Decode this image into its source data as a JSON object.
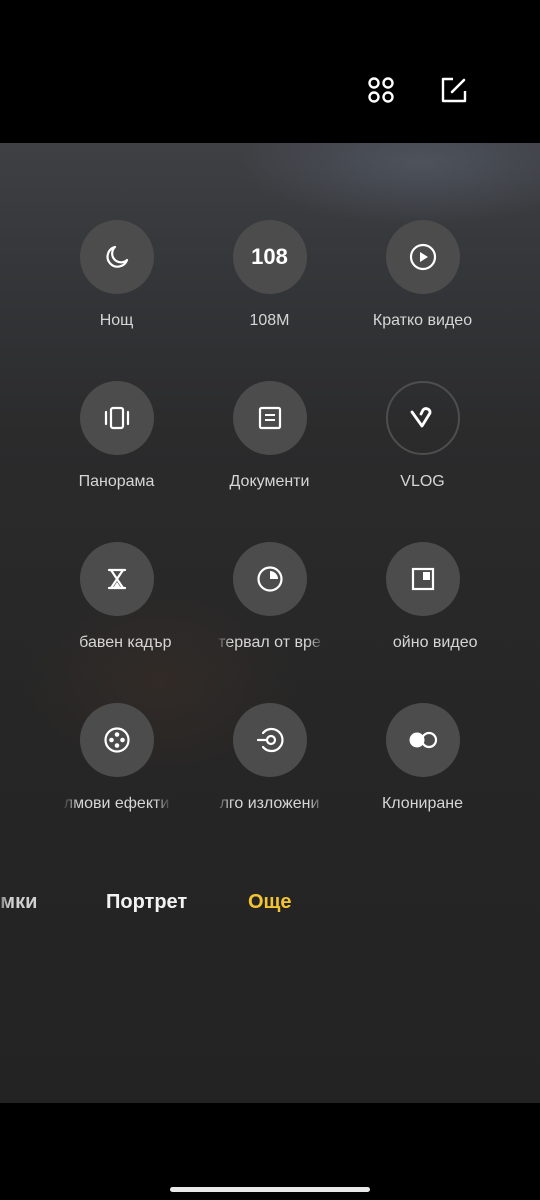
{
  "toolbar": {
    "grid_icon": "grid-icon",
    "edit_icon": "edit-icon"
  },
  "modes": [
    {
      "label": "Нощ",
      "icon": "moon-icon"
    },
    {
      "label": "108M",
      "icon": "108-icon",
      "icon_text": "108"
    },
    {
      "label": "Кратко видео",
      "icon": "play-circle-icon"
    },
    {
      "label": "Панорама",
      "icon": "panorama-icon"
    },
    {
      "label": "Документи",
      "icon": "document-icon"
    },
    {
      "label": "VLOG",
      "icon": "vlog-icon"
    },
    {
      "label": "бавен кадър",
      "icon": "hourglass-icon"
    },
    {
      "label": "тервал от вре",
      "icon": "timer-icon"
    },
    {
      "label": "ойно видео",
      "icon": "dual-video-icon"
    },
    {
      "label": "лмови ефекти",
      "icon": "film-reel-icon"
    },
    {
      "label": "лго изложени",
      "icon": "long-exposure-icon"
    },
    {
      "label": "Клониране",
      "icon": "clone-icon"
    }
  ],
  "tabs": {
    "left": "имки",
    "middle": "Портрет",
    "active": "Още"
  },
  "colors": {
    "active_tab": "#f3c532",
    "circle_bg": "#4c4c4c"
  }
}
